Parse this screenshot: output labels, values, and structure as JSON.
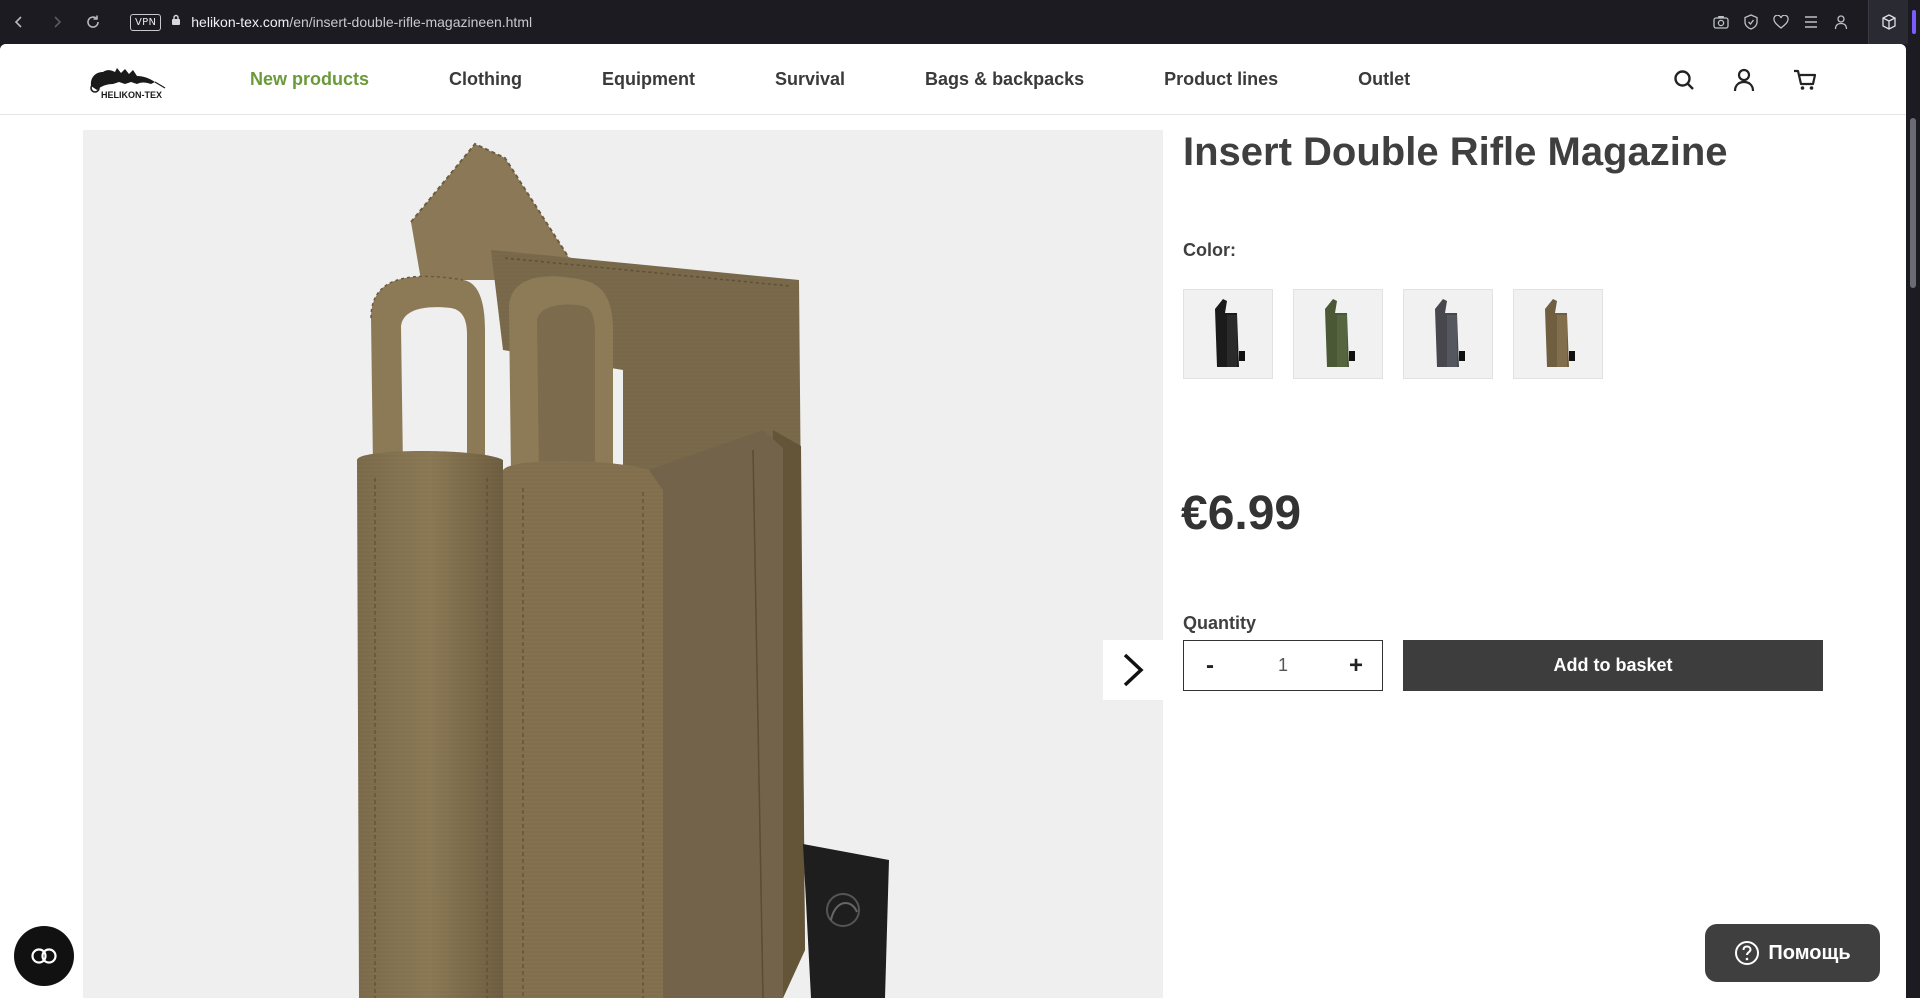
{
  "browser": {
    "vpn_label": "VPN",
    "url_host": "helikon-tex.com",
    "url_path": "/en/insert-double-rifle-magazineen.html"
  },
  "site": {
    "logo_text": "HELIKON-TEX",
    "nav": [
      {
        "label": "New products",
        "active": true
      },
      {
        "label": "Clothing"
      },
      {
        "label": "Equipment"
      },
      {
        "label": "Survival"
      },
      {
        "label": "Bags & backpacks"
      },
      {
        "label": "Product lines"
      },
      {
        "label": "Outlet"
      }
    ],
    "accent_color": "#6a9a3a"
  },
  "product": {
    "title": "Insert Double Rifle Magazine",
    "color_label": "Color:",
    "swatches": [
      {
        "color": "#1a1a1a"
      },
      {
        "color": "#4c5a34"
      },
      {
        "color": "#4a4c52"
      },
      {
        "color": "#6e5e40"
      }
    ],
    "price": "€6.99",
    "quantity_label": "Quantity",
    "quantity_value": "1",
    "minus_label": "-",
    "plus_label": "+",
    "add_to_basket_label": "Add to basket"
  },
  "widgets": {
    "help_label": "Помощь"
  }
}
